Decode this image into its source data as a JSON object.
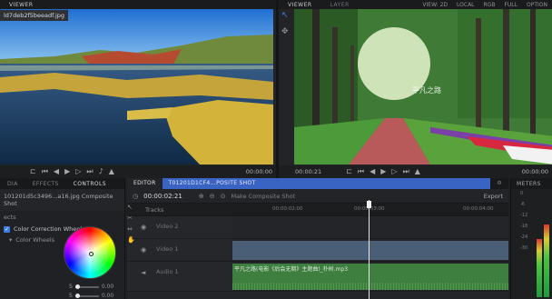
{
  "viewer_left": {
    "tabs": [
      "VIEWER"
    ],
    "clip_name": "ld7deb2f5beeadf.jpg",
    "timecode_right": "00:00:00"
  },
  "viewer_right": {
    "tabs": [
      "VIEWER",
      "LAYER"
    ],
    "view_mode": "VIEW: 2D",
    "space": "LOCAL",
    "channel": "RGB",
    "zoom": "FULL",
    "options": "OPTION",
    "watermark": "平凡之路",
    "timecode_left": "00:00:21",
    "timecode_right": "00:00:00"
  },
  "left_panel": {
    "tabs": [
      "DIA",
      "EFFECTS",
      "CONTROLS"
    ],
    "composite_title": "101201d5c3496...a16.jpg Composite Shot",
    "section": "ects",
    "color_correction": "Color Correction Wheels",
    "color_wheels": "Color Wheels",
    "slider1_value": "0.00",
    "slider2_value": "0.00",
    "slider1_label": "S",
    "slider2_label": "S"
  },
  "editor": {
    "tabs": [
      "EDITOR",
      "T01201D1CF4...POSITE SHOT"
    ],
    "timecode": "00:00:02:21",
    "make_composite": "Make Composite Shot",
    "export": "Export",
    "tracks_label": "Tracks",
    "ruler_ticks": [
      "00:00:02:00",
      "00:00:03:00",
      "00:00:04:00"
    ],
    "tracks": [
      {
        "name": "Video 2",
        "kind": "video"
      },
      {
        "name": "Video 1",
        "kind": "video"
      },
      {
        "name": "Audio 1",
        "kind": "audio",
        "clip_label": "平凡之路(电影《后会无期》主题曲)_朴树.mp3"
      }
    ]
  },
  "meters": {
    "title": "METERS",
    "scale": [
      "0",
      "-6",
      "-12",
      "-18",
      "-24",
      "-30"
    ],
    "levels": [
      0.55,
      0.68
    ]
  },
  "colors": {
    "accent_blue": "#3a64c4",
    "audio_green": "#3e7f3f",
    "video_clip": "#4a5f76"
  }
}
